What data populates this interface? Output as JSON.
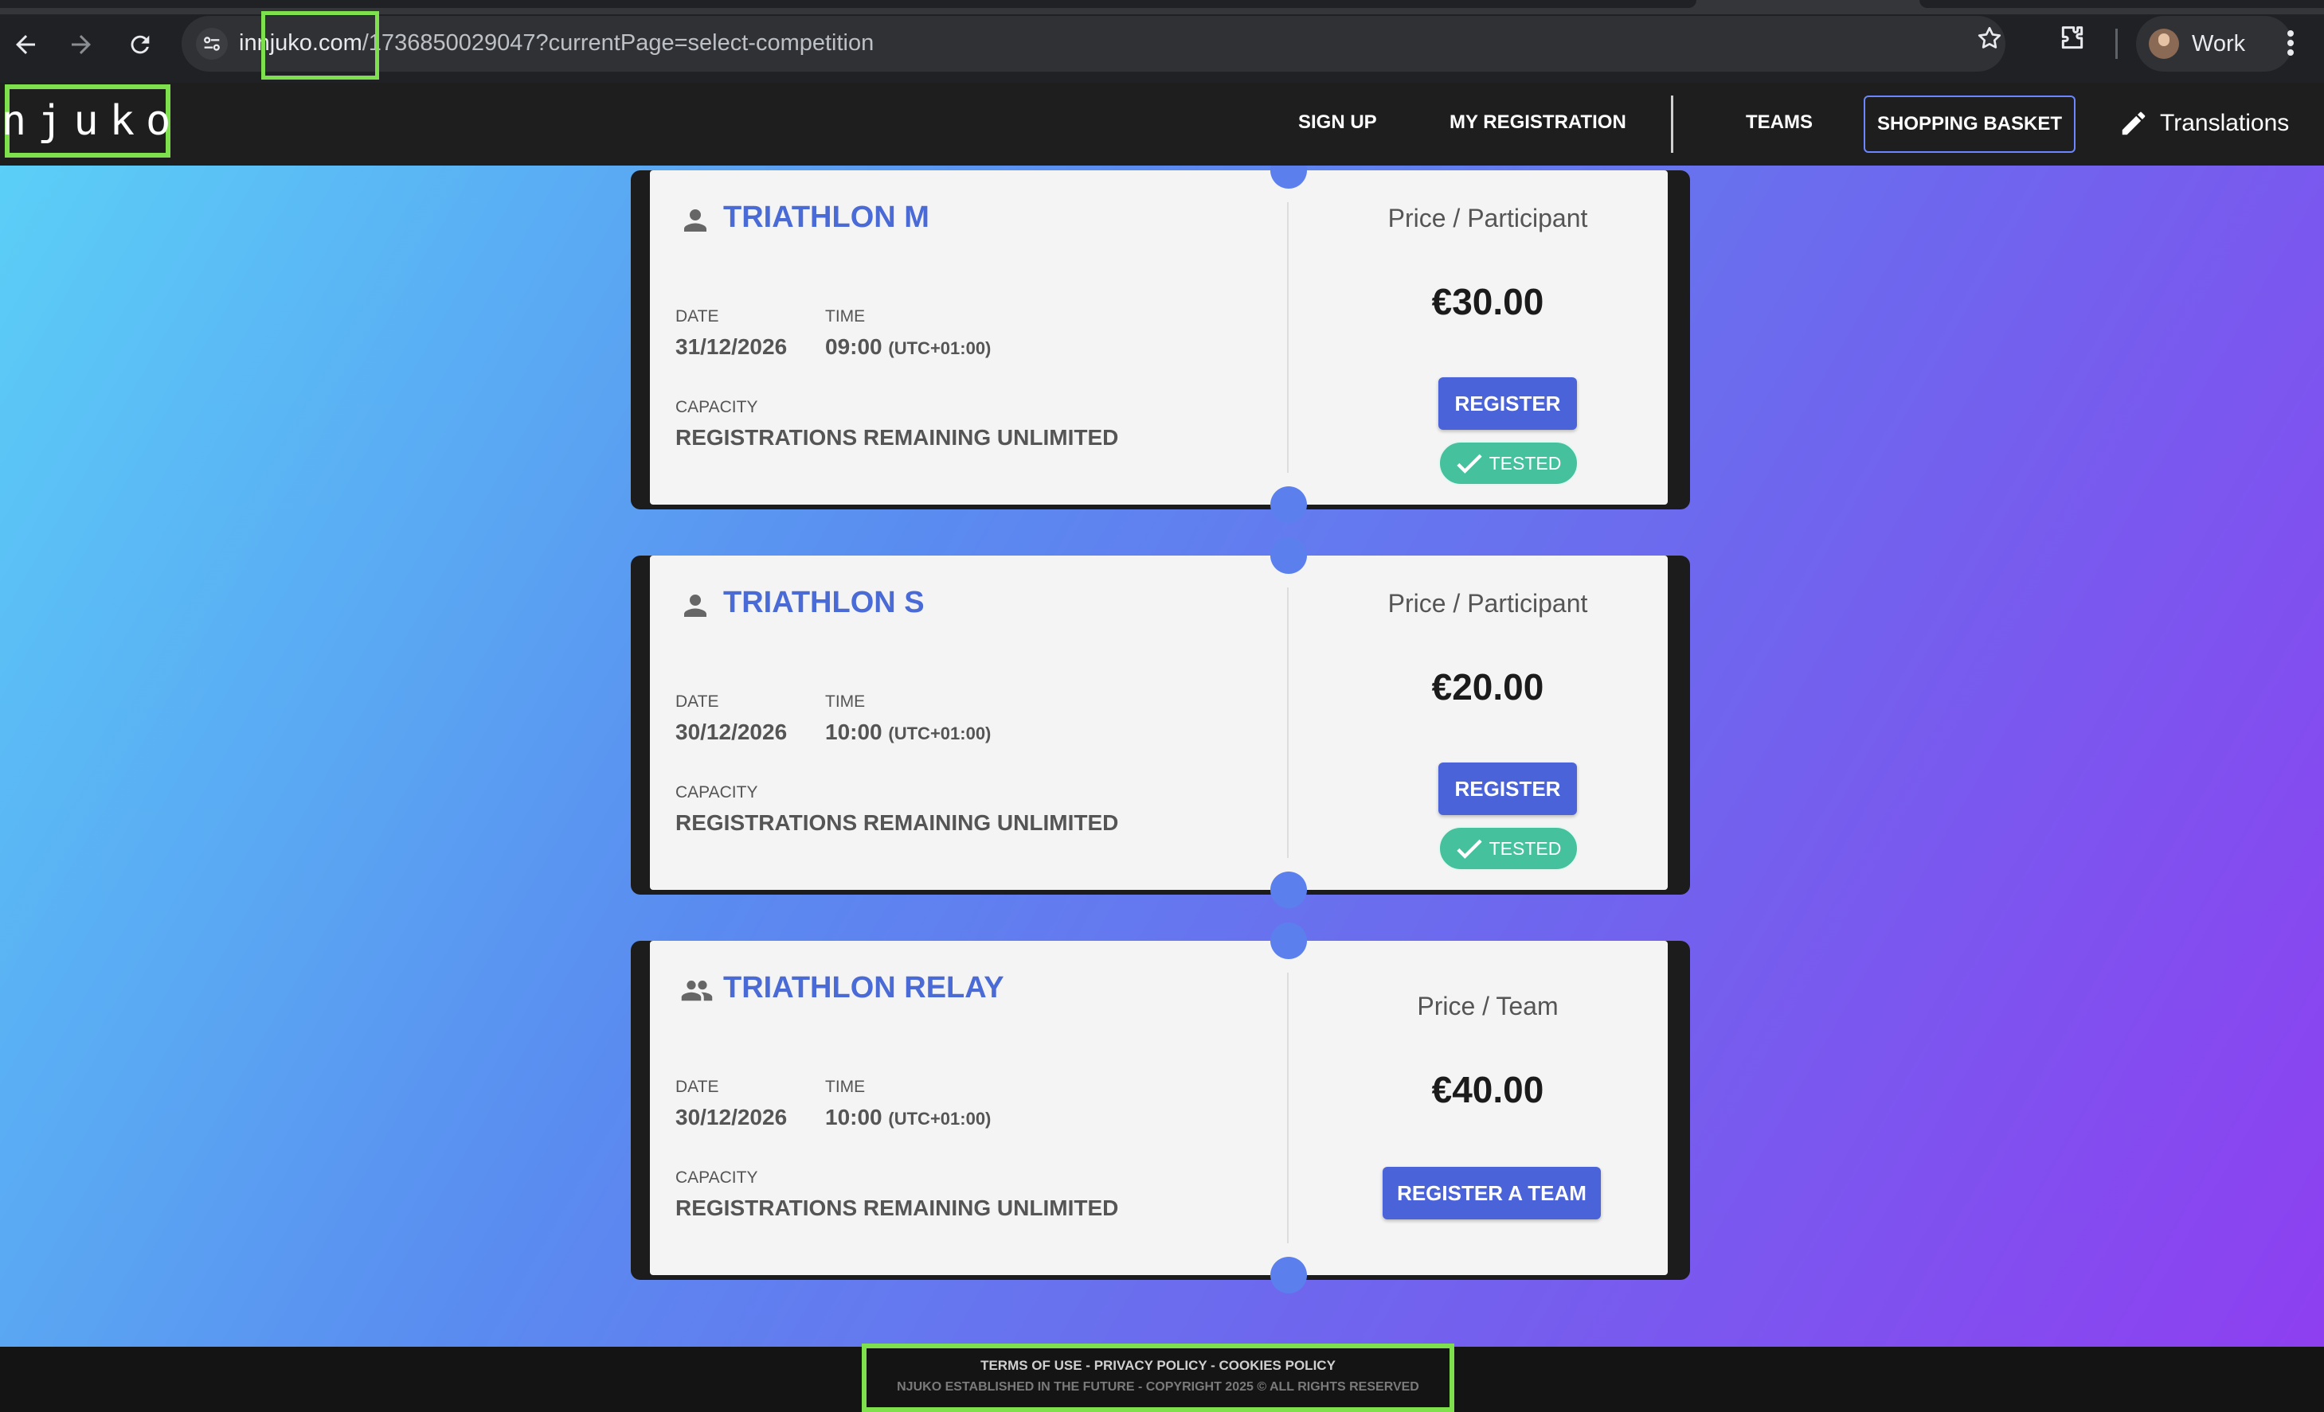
{
  "browser": {
    "url_prefix": "in",
    "url_host": "njuko.com",
    "url_path": "/1736850029047?currentPage=select-competition",
    "profile_label": "Work",
    "icons": [
      "back-icon",
      "forward-icon",
      "reload-icon",
      "site-settings-icon",
      "bookmark-star-icon",
      "extensions-icon",
      "menu-icon"
    ]
  },
  "header": {
    "logo_text": "njuko",
    "nav": {
      "sign_up": "SIGN UP",
      "my_registration": "MY REGISTRATION",
      "teams": "TEAMS",
      "shopping_basket": "SHOPPING BASKET",
      "translations": "Translations"
    }
  },
  "competitions": [
    {
      "title": "TRIATHLON M",
      "icon": "person-icon",
      "date_label": "DATE",
      "date": "31/12/2026",
      "time_label": "TIME",
      "time": "09:00",
      "timezone": "(UTC+01:00)",
      "capacity_label": "CAPACITY",
      "capacity": "REGISTRATIONS REMAINING UNLIMITED",
      "price_label": "Price / Participant",
      "price": "€30.00",
      "button": "REGISTER",
      "badge": "TESTED"
    },
    {
      "title": "TRIATHLON S",
      "icon": "person-icon",
      "date_label": "DATE",
      "date": "30/12/2026",
      "time_label": "TIME",
      "time": "10:00",
      "timezone": "(UTC+01:00)",
      "capacity_label": "CAPACITY",
      "capacity": "REGISTRATIONS REMAINING UNLIMITED",
      "price_label": "Price / Participant",
      "price": "€20.00",
      "button": "REGISTER",
      "badge": "TESTED"
    },
    {
      "title": "TRIATHLON RELAY",
      "icon": "group-icon",
      "date_label": "DATE",
      "date": "30/12/2026",
      "time_label": "TIME",
      "time": "10:00",
      "timezone": "(UTC+01:00)",
      "capacity_label": "CAPACITY",
      "capacity": "REGISTRATIONS REMAINING UNLIMITED",
      "price_label": "Price / Team",
      "price": "€40.00",
      "button": "REGISTER A TEAM"
    }
  ],
  "footer": {
    "terms": "TERMS OF USE",
    "privacy": "PRIVACY POLICY",
    "cookies": "COOKIES POLICY",
    "separator": " - ",
    "copyright": "NJUKO ESTABLISHED IN THE FUTURE - COPYRIGHT 2025 © ALL RIGHTS RESERVED"
  },
  "colors": {
    "accent": "#4b63d8",
    "title_blue": "#4a6ad6",
    "tested_green": "#45c19e",
    "highlight_green": "#7ee04c",
    "header_bg": "#1e1e1e"
  }
}
